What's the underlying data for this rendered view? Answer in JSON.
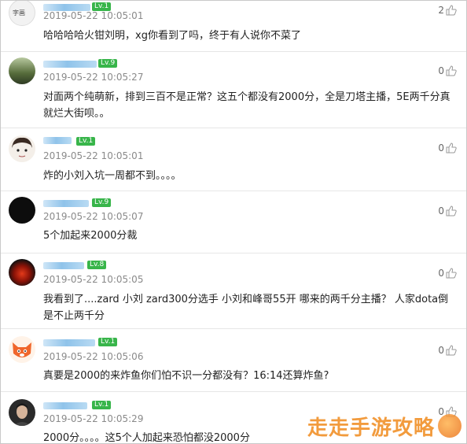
{
  "comments": [
    {
      "level": "Lv.1",
      "time": "2019-05-22 10:05:01",
      "text": "哈哈哈哈火钳刘明，xg你看到了吗，终于有人说你不菜了",
      "likes": "2",
      "avatar_icon": "calligraphy-avatar-icon"
    },
    {
      "level": "Lv.9",
      "time": "2019-05-22 10:05:27",
      "text": "对面两个纯萌新，排到三百不是正常？这五个都没有2000分，全是刀塔主播，5E两千分真就烂大街呗。。",
      "likes": "0",
      "avatar_icon": "landscape-avatar-icon"
    },
    {
      "level": "Lv.1",
      "time": "2019-05-22 10:05:01",
      "text": "炸的小刘入坑一周都不到。。。。",
      "likes": "0",
      "avatar_icon": "cartoon-face-avatar-icon"
    },
    {
      "level": "Lv.9",
      "time": "2019-05-22 10:05:07",
      "text": "5个加起来2000分裁",
      "likes": "0",
      "avatar_icon": "dark-avatar-icon"
    },
    {
      "level": "Lv.8",
      "time": "2019-05-22 10:05:05",
      "text": "我看到了....zard 小刘 zard300分选手 小刘和峰哥55开 哪来的两千分主播？ 人家dota倒是不止两千分",
      "likes": "0",
      "avatar_icon": "red-orb-avatar-icon"
    },
    {
      "level": "Lv.1",
      "time": "2019-05-22 10:05:06",
      "text": "真要是2000的来炸鱼你们怕不识一分都没有？16:14还算炸鱼?",
      "likes": "0",
      "avatar_icon": "fox-cartoon-avatar-icon"
    },
    {
      "level": "Lv.1",
      "time": "2019-05-22 10:05:29",
      "text": "2000分。。。。这5个人加起来恐怕都没2000分",
      "likes": "0",
      "avatar_icon": "man-portrait-avatar-icon"
    }
  ],
  "watermark": {
    "text": "走走手游攻略"
  },
  "colors": {
    "level_badge": "#38b54a",
    "timestamp": "#8a8a8a",
    "watermark": "#f08a1c"
  }
}
